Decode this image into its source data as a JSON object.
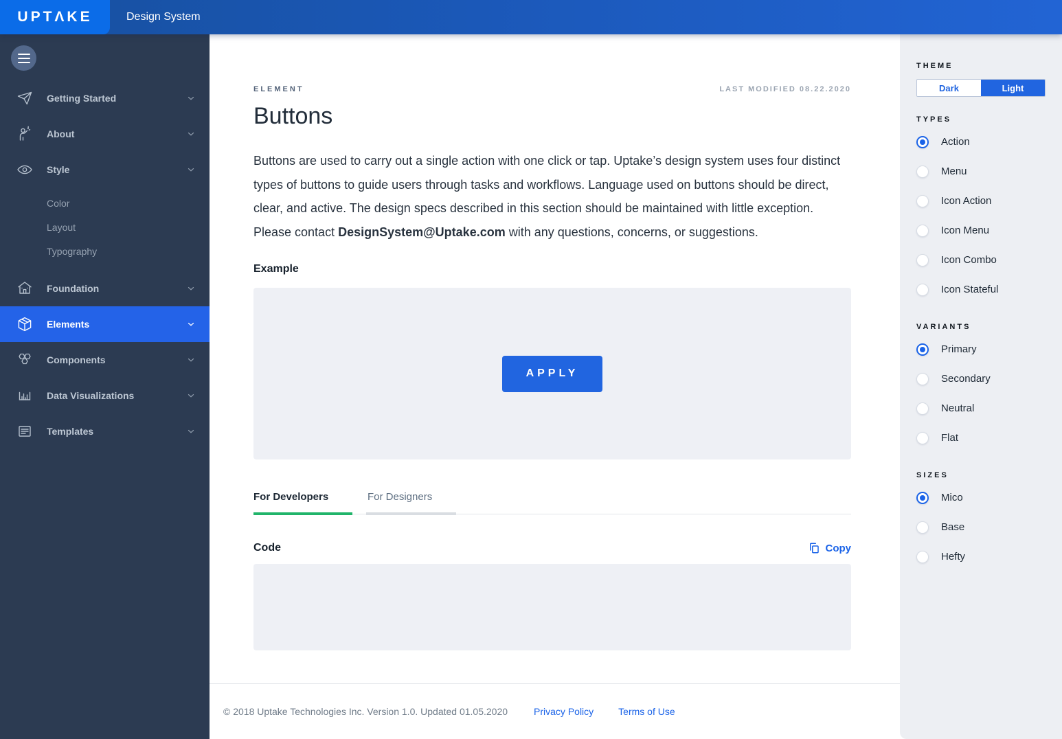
{
  "header": {
    "logo": "UPTΛKE",
    "title": "Design System"
  },
  "sidebar": {
    "items": [
      {
        "label": "Getting Started",
        "icon": "paper-plane"
      },
      {
        "label": "About",
        "icon": "person-waving"
      },
      {
        "label": "Style",
        "icon": "eye"
      },
      {
        "label": "Foundation",
        "icon": "bank"
      },
      {
        "label": "Elements",
        "icon": "cube",
        "active": true
      },
      {
        "label": "Components",
        "icon": "hexagon-cluster"
      },
      {
        "label": "Data Visualizations",
        "icon": "bar-chart"
      },
      {
        "label": "Templates",
        "icon": "document-lines"
      }
    ],
    "style_children": [
      {
        "label": "Color"
      },
      {
        "label": "Layout"
      },
      {
        "label": "Typography"
      }
    ]
  },
  "main": {
    "eyebrow": "ELEMENT",
    "last_modified": "LAST MODIFIED 08.22.2020",
    "title": "Buttons",
    "paragraph_before": "Buttons are used to carry out a single action with one click or tap. Uptake’s design system uses four distinct types of buttons to guide users through tasks and workflows. Language used on buttons should be direct, clear, and active. The design specs described in this section should be maintained with little exception. Please contact ",
    "email": "DesignSystem@Uptake.com",
    "paragraph_after": " with any questions, concerns, or suggestions.",
    "example_label": "Example",
    "apply_button_label": "APPLY",
    "tabs": [
      {
        "label": "For Developers",
        "active": true
      },
      {
        "label": "For Designers",
        "active": false
      }
    ],
    "code_label": "Code",
    "copy_label": "Copy"
  },
  "footer": {
    "text": "© 2018 Uptake Technologies Inc.  Version 1.0. Updated 01.05.2020",
    "links": [
      {
        "label": "Privacy Policy"
      },
      {
        "label": "Terms of Use"
      }
    ]
  },
  "panel": {
    "theme": {
      "label": "THEME",
      "options": [
        {
          "label": "Dark",
          "active": false
        },
        {
          "label": "Light",
          "active": true
        }
      ]
    },
    "types": {
      "label": "TYPES",
      "options": [
        {
          "label": "Action",
          "selected": true
        },
        {
          "label": "Menu",
          "selected": false
        },
        {
          "label": "Icon Action",
          "selected": false
        },
        {
          "label": "Icon Menu",
          "selected": false
        },
        {
          "label": "Icon Combo",
          "selected": false
        },
        {
          "label": "Icon Stateful",
          "selected": false
        }
      ]
    },
    "variants": {
      "label": "VARIANTS",
      "options": [
        {
          "label": "Primary",
          "selected": true
        },
        {
          "label": "Secondary",
          "selected": false
        },
        {
          "label": "Neutral",
          "selected": false
        },
        {
          "label": "Flat",
          "selected": false
        }
      ]
    },
    "sizes": {
      "label": "SIZES",
      "options": [
        {
          "label": "Mico",
          "selected": true
        },
        {
          "label": "Base",
          "selected": false
        },
        {
          "label": "Hefty",
          "selected": false
        }
      ]
    }
  },
  "colors": {
    "accent_blue": "#2165e0",
    "link_blue": "#1a63e8",
    "logo_blue": "#0b6ce8",
    "topbar_blue": "#1b58b8",
    "sidebar_navy": "#2c3b52",
    "active_nav_blue": "#2463e8",
    "tab_green": "#21b46a",
    "panel_gray": "#edeff3",
    "box_gray": "#eef0f5"
  }
}
